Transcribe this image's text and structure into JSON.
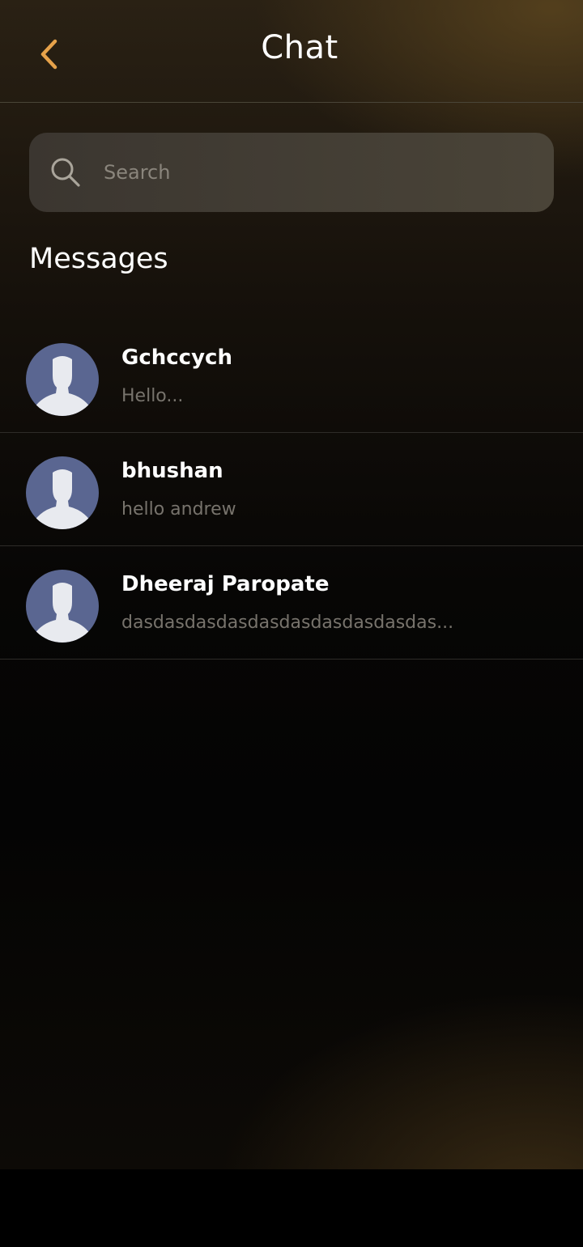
{
  "header": {
    "title": "Chat",
    "back_icon": "chevron-left-icon",
    "accent_color": "#e6a24a"
  },
  "search": {
    "placeholder": "Search",
    "value": "",
    "icon": "search-icon"
  },
  "messages_section": {
    "heading": "Messages"
  },
  "conversations": [
    {
      "name": "Gchccych",
      "last_message": "Hello...",
      "avatar": "default-user-avatar"
    },
    {
      "name": "bhushan",
      "last_message": "hello andrew",
      "avatar": "default-user-avatar"
    },
    {
      "name": "Dheeraj Paropate",
      "last_message": "dasdasdasdasdasdasdasdasdasdas...",
      "avatar": "default-user-avatar"
    }
  ],
  "colors": {
    "avatar_bg": "#5a6691",
    "avatar_figure": "#e8eaef"
  }
}
